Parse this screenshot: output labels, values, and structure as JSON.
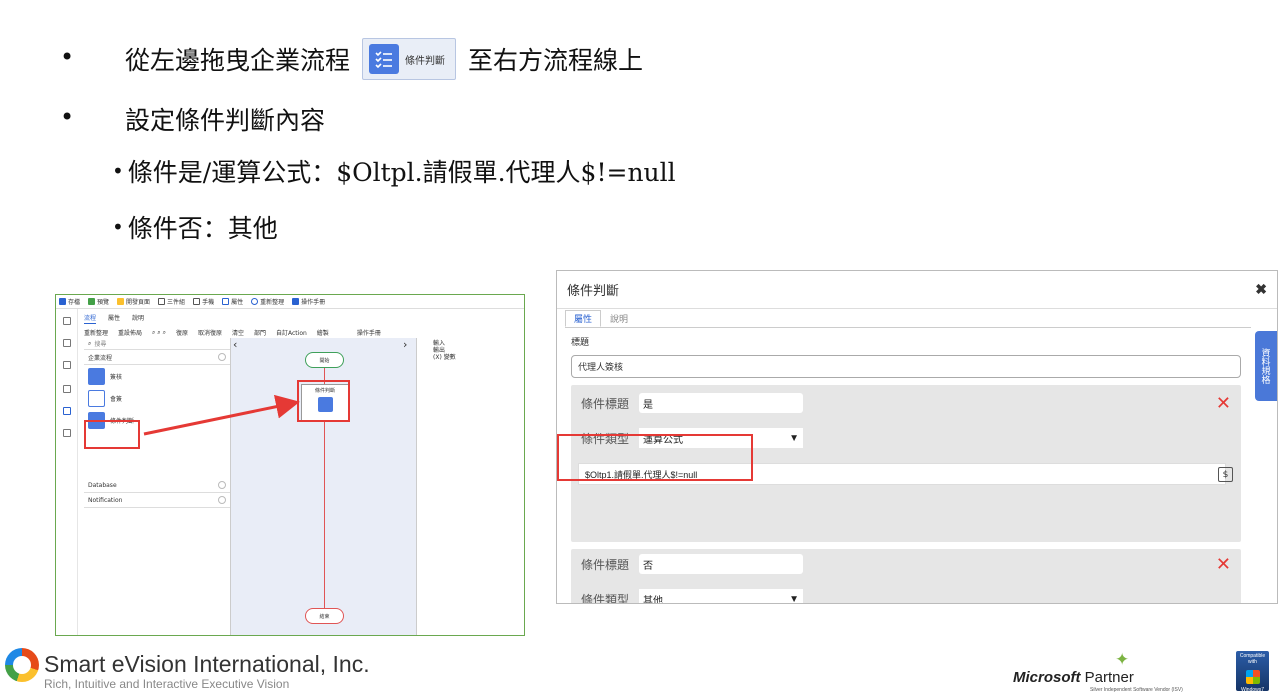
{
  "slide": {
    "bullet1_pre": "從左邊拖曳企業流程",
    "bullet1_post": "至右方流程線上",
    "bullet1_chip": "條件判斷",
    "bullet2": "設定條件判斷內容",
    "sub1": "條件是/運算公式：$Oltpl.請假單.代理人$!=null",
    "sub2": "條件否：其他",
    "bullet_glyph": "•"
  },
  "designer": {
    "toolbar": [
      "存檔",
      "預覽",
      "開發頁面",
      "三件組",
      "手機",
      "屬性",
      "重新整理",
      "操作手冊"
    ],
    "tabs": [
      "流程",
      "屬性",
      "說明"
    ],
    "tools": [
      "重新整理",
      "重設佈局",
      "復原",
      "取消復原",
      "清空",
      "部門",
      "自訂Action",
      "繪製",
      "操作手冊"
    ],
    "search_placeholder": "搜尋",
    "groups": {
      "flow": "企業流程",
      "database": "Database",
      "notification": "Notification"
    },
    "items": [
      "簽核",
      "會簽",
      "條件判斷"
    ],
    "canvas": {
      "start": "開始",
      "condition": "條件判斷",
      "end": "結束"
    },
    "io": [
      "輸入",
      "輸出",
      "(X) 變數"
    ]
  },
  "dialog": {
    "title": "條件判斷",
    "close_glyph": "✖",
    "tabs": [
      "屬性",
      "說明"
    ],
    "title_label": "標題",
    "title_value": "代理人簽核",
    "side_tab": "資料規格",
    "cond_title_label": "條件標題",
    "cond_type_label": "條件類型",
    "yes": {
      "title": "是",
      "type": "運算公式",
      "formula": "$Oltp1.請假單.代理人$!=null"
    },
    "no": {
      "title": "否",
      "type": "其他"
    },
    "delete_glyph": "✕",
    "dropdown_glyph": "▼"
  },
  "footer": {
    "company": "Smart eVision International, Inc.",
    "tagline": "Rich, Intuitive and Interactive Executive Vision",
    "ms_brand": "Microsoft",
    "ms_partner": "Partner",
    "ms_sub": "Silver Independent Software Vendor (ISV)",
    "win_badge_top": "Compatible with",
    "win_badge_bottom": "Windows7"
  },
  "colors": {
    "accent_blue": "#4a7ae0",
    "highlight_red": "#e53935",
    "flow_line": "#e05555",
    "start_green": "#3fa05a"
  }
}
